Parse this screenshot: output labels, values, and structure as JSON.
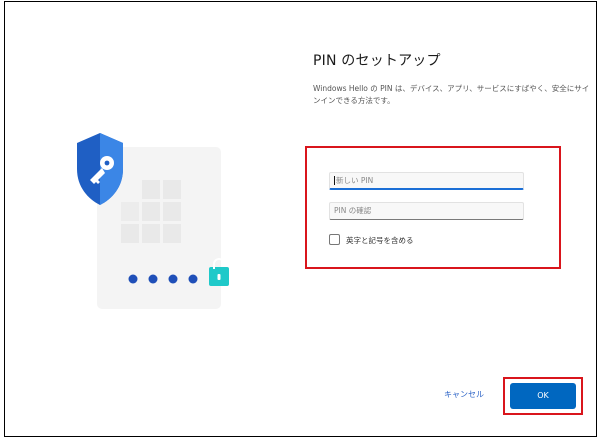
{
  "setup": {
    "title": "PIN のセットアップ",
    "description": "Windows Hello の PIN は、デバイス、アプリ、サービスにすばやく、安全にサインインできる方法です。"
  },
  "form": {
    "new_pin_placeholder": "新しい PIN",
    "confirm_pin_placeholder": "PIN の確認",
    "include_letters_label": "英字と記号を含める",
    "include_letters_checked": false
  },
  "actions": {
    "cancel_label": "キャンセル",
    "ok_label": "OK"
  },
  "colors": {
    "accent": "#0067c0",
    "highlight": "#d9151c",
    "shield": "#1f5fc4",
    "lock": "#1fc9c9"
  },
  "icons": [
    "shield-key-icon",
    "pin-keypad-icon",
    "padlock-icon"
  ]
}
